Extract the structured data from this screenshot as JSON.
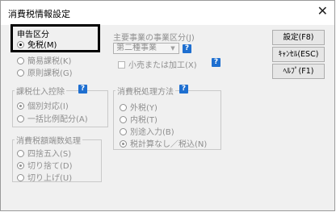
{
  "window": {
    "title": "消費税情報設定",
    "close_glyph": "✕"
  },
  "tax_category": {
    "label": "申告区分",
    "options": [
      "免税(M)",
      "簡易課税(K)",
      "原則課税(G)"
    ],
    "selected_index": 0
  },
  "main_business": {
    "label": "主要事業の事業区分(J)",
    "value": "第二種事業",
    "checkbox_label": "小売または加工(X)",
    "checked": false
  },
  "purchase_deduction": {
    "label": "課税仕入控除",
    "options": [
      "個別対応(I)",
      "一括比例配分(A)"
    ],
    "selected_index": 0
  },
  "rounding": {
    "label": "消費税額端数処理",
    "options": [
      "四捨五入(S)",
      "切り捨て(D)",
      "切り上げ(U)"
    ],
    "selected_index": 1
  },
  "tax_method": {
    "label": "消費税処理方法",
    "options": [
      "外税(Y)",
      "内税(T)",
      "別途入力(B)",
      "税計算なし／税込(N)"
    ],
    "selected_index": 3
  },
  "buttons": {
    "settings": "設定(F8)",
    "cancel": "ｷｬﾝｾﾙ(ESC)",
    "help": "ﾍﾙﾌﾟ(F1)"
  },
  "help_glyph": "?"
}
